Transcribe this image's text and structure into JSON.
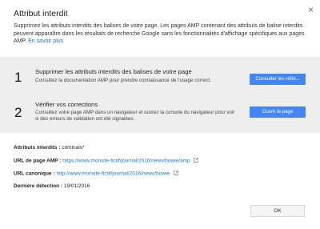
{
  "dialog": {
    "title": "Attribut interdit",
    "close_glyph": "×",
    "intro_text": "Supprimez les attributs interdits des balises de votre page. Les pages AMP contenant des attributs de balise interdits peuvent apparaître dans les résultats de recherche Google sans les fonctionnalités d'affichage spécifiques aux pages AMP.",
    "learn_more": "En savoir plus"
  },
  "steps": [
    {
      "number": "1",
      "title": "Supprimer les attributs interdits des balises de votre page",
      "description": "Consultez la documentation AMP pour prendre connaissance de l'usage correct.",
      "button_label": "Consulter les référ..."
    },
    {
      "number": "2",
      "title": "Vérifier vos corrections",
      "description": "Consultez votre page AMP dans un navigateur et ouvrez la console du navigateur pour voir si des erreurs de validation ont été signalées.",
      "button_label": "Ouvrir la page"
    }
  ],
  "details": {
    "forbidden_attributes_label": "Attributs interdits :",
    "forbidden_attributes_value": "criminals*",
    "amp_url_label": "URL de page AMP :",
    "amp_url_value": "https://www.monsite-fictif/journal/2016/news/bowie/amp",
    "canonical_url_label": "URL canonique :",
    "canonical_url_value": "http://www.monsite-fictif/journal/2016/news/bowie",
    "last_detection_label": "Dernière détection :",
    "last_detection_value": "19/01/2016"
  },
  "footer": {
    "ok_label": "OK"
  },
  "icons": {
    "close": "close-icon",
    "external_link": "external-link-icon"
  },
  "colors": {
    "primary_button": "#4285f4",
    "link": "#1a73e8",
    "steps_background": "#eeeeee"
  }
}
